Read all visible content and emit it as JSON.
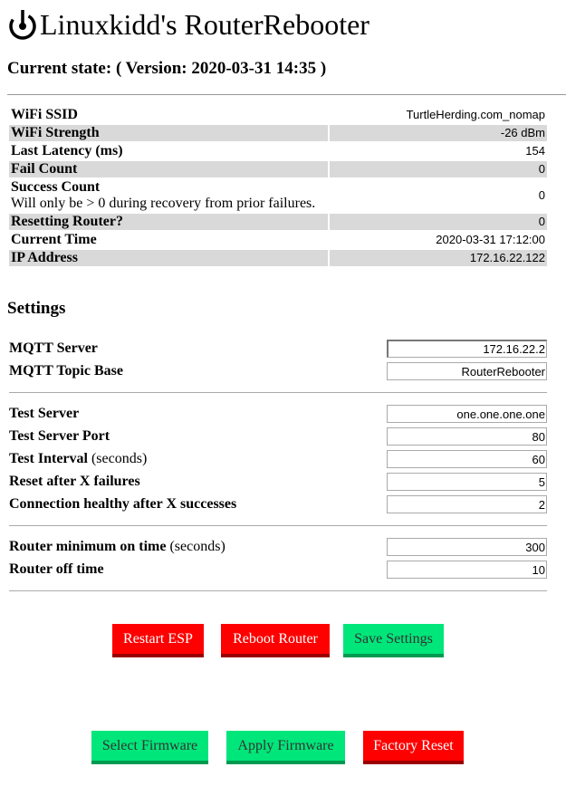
{
  "header": {
    "title": "Linuxkidd's RouterRebooter",
    "logo_icon": "power-cycle-icon"
  },
  "state": {
    "prefix": "Current state:",
    "version_label": "( Version: 2020-03-31 14:35 )"
  },
  "status": {
    "rows": [
      {
        "label": "WiFi SSID",
        "value": "TurtleHerding.com_nomap"
      },
      {
        "label": "WiFi Strength",
        "value": "-26 dBm"
      },
      {
        "label": "Last Latency (ms)",
        "value": "154"
      },
      {
        "label": "Fail Count",
        "value": "0"
      },
      {
        "label": "Success Count",
        "sublabel": "Will only be > 0 during recovery from prior failures.",
        "value": "0"
      },
      {
        "label": "Resetting Router?",
        "value": "0"
      },
      {
        "label": "Current Time",
        "value": "2020-03-31 17:12:00"
      },
      {
        "label": "IP Address",
        "value": "172.16.22.122"
      }
    ]
  },
  "settings": {
    "heading": "Settings",
    "mqtt_server": {
      "label": "MQTT Server",
      "value": "172.16.22.2"
    },
    "mqtt_topic": {
      "label": "MQTT Topic Base",
      "value": "RouterRebooter"
    },
    "test_server": {
      "label": "Test Server",
      "value": "one.one.one.one"
    },
    "test_port": {
      "label": "Test Server Port",
      "value": "80"
    },
    "test_interval": {
      "label": "Test Interval",
      "unit": "(seconds)",
      "value": "60"
    },
    "reset_after": {
      "label": "Reset after X failures",
      "value": "5"
    },
    "healthy_after": {
      "label": "Connection healthy after X successes",
      "value": "2"
    },
    "router_min_on": {
      "label": "Router minimum on time",
      "unit": "(seconds)",
      "value": "300"
    },
    "router_off": {
      "label": "Router off time",
      "value": "10"
    }
  },
  "buttons": {
    "restart_esp": "Restart ESP",
    "reboot_router": "Reboot Router",
    "save_settings": "Save Settings",
    "select_firmware": "Select Firmware",
    "apply_firmware": "Apply Firmware",
    "factory_reset": "Factory Reset"
  },
  "colors": {
    "red": "#ff0000",
    "green": "#00e67a",
    "row_shade": "#d9d9d9"
  }
}
